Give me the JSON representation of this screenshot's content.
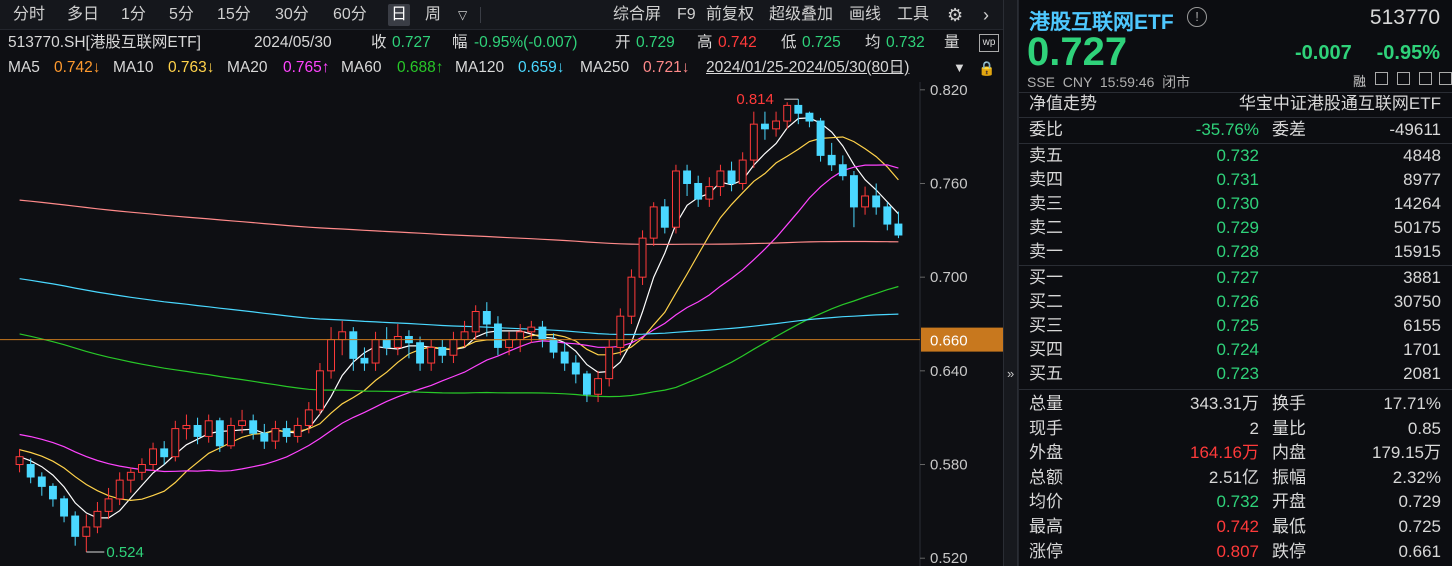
{
  "toolbar": {
    "periods": [
      "分时",
      "多日",
      "1分",
      "5分",
      "15分",
      "30分",
      "60分",
      "日",
      "周"
    ],
    "selected": "日",
    "dropdown_icon": "caret-down-icon",
    "tools": [
      "综合屏",
      "F9",
      "前复权",
      "超级叠加",
      "画线",
      "工具"
    ],
    "settings_icon": "gear-icon",
    "next_icon": "chevron-right-icon"
  },
  "info": {
    "code_name": "513770.SH[港股互联网ETF]",
    "date": "2024/05/30",
    "close_label": "收",
    "close": "0.727",
    "change_label": "幅",
    "change": "-0.95%(-0.007)",
    "open_label": "开",
    "open": "0.729",
    "high_label": "高",
    "high": "0.742",
    "low_label": "低",
    "low": "0.725",
    "avg_label": "均",
    "avg": "0.732",
    "vol_label": "量"
  },
  "ma": {
    "ma5": "MA5",
    "ma5_val": "0.742↓",
    "ma10": "MA10",
    "ma10_val": "0.763↓",
    "ma20": "MA20",
    "ma20_val": "0.765↑",
    "ma60": "MA60",
    "ma60_val": "0.688↑",
    "ma120": "MA120",
    "ma120_val": "0.659↓",
    "ma250": "MA250",
    "ma250_val": "0.721↓",
    "range": "2024/01/25-2024/05/30(80日)"
  },
  "chart_data": {
    "type": "candlestick",
    "y_ticks": [
      "0.820",
      "0.760",
      "0.700",
      "0.640",
      "0.580",
      "0.520"
    ],
    "ylim": [
      0.515,
      0.825
    ],
    "price_marker": "0.660",
    "high_annotation": "0.814",
    "low_annotation": "0.524",
    "candles": [
      [
        0.58,
        0.585,
        0.575,
        0.59
      ],
      [
        0.58,
        0.572,
        0.568,
        0.584
      ],
      [
        0.572,
        0.566,
        0.56,
        0.575
      ],
      [
        0.566,
        0.558,
        0.553,
        0.568
      ],
      [
        0.558,
        0.547,
        0.543,
        0.56
      ],
      [
        0.547,
        0.534,
        0.528,
        0.55
      ],
      [
        0.534,
        0.54,
        0.524,
        0.548
      ],
      [
        0.54,
        0.55,
        0.536,
        0.556
      ],
      [
        0.55,
        0.558,
        0.545,
        0.565
      ],
      [
        0.558,
        0.57,
        0.554,
        0.575
      ],
      [
        0.57,
        0.575,
        0.562,
        0.578
      ],
      [
        0.575,
        0.58,
        0.57,
        0.584
      ],
      [
        0.58,
        0.59,
        0.576,
        0.594
      ],
      [
        0.59,
        0.585,
        0.58,
        0.595
      ],
      [
        0.585,
        0.603,
        0.582,
        0.608
      ],
      [
        0.603,
        0.605,
        0.596,
        0.612
      ],
      [
        0.605,
        0.598,
        0.593,
        0.61
      ],
      [
        0.598,
        0.608,
        0.594,
        0.612
      ],
      [
        0.608,
        0.592,
        0.588,
        0.61
      ],
      [
        0.592,
        0.605,
        0.59,
        0.61
      ],
      [
        0.605,
        0.608,
        0.6,
        0.615
      ],
      [
        0.608,
        0.6,
        0.596,
        0.612
      ],
      [
        0.6,
        0.595,
        0.59,
        0.606
      ],
      [
        0.595,
        0.603,
        0.59,
        0.608
      ],
      [
        0.603,
        0.598,
        0.594,
        0.608
      ],
      [
        0.598,
        0.605,
        0.594,
        0.61
      ],
      [
        0.605,
        0.615,
        0.6,
        0.62
      ],
      [
        0.615,
        0.64,
        0.612,
        0.645
      ],
      [
        0.64,
        0.66,
        0.635,
        0.668
      ],
      [
        0.66,
        0.665,
        0.65,
        0.672
      ],
      [
        0.665,
        0.648,
        0.64,
        0.668
      ],
      [
        0.648,
        0.645,
        0.64,
        0.655
      ],
      [
        0.645,
        0.66,
        0.64,
        0.665
      ],
      [
        0.66,
        0.655,
        0.65,
        0.668
      ],
      [
        0.655,
        0.662,
        0.65,
        0.67
      ],
      [
        0.662,
        0.658,
        0.648,
        0.666
      ],
      [
        0.658,
        0.645,
        0.64,
        0.662
      ],
      [
        0.645,
        0.655,
        0.64,
        0.66
      ],
      [
        0.655,
        0.65,
        0.645,
        0.66
      ],
      [
        0.65,
        0.66,
        0.645,
        0.665
      ],
      [
        0.66,
        0.665,
        0.655,
        0.672
      ],
      [
        0.665,
        0.678,
        0.66,
        0.682
      ],
      [
        0.678,
        0.67,
        0.662,
        0.684
      ],
      [
        0.67,
        0.655,
        0.65,
        0.675
      ],
      [
        0.655,
        0.66,
        0.65,
        0.665
      ],
      [
        0.66,
        0.665,
        0.652,
        0.67
      ],
      [
        0.665,
        0.668,
        0.658,
        0.672
      ],
      [
        0.668,
        0.66,
        0.655,
        0.672
      ],
      [
        0.66,
        0.652,
        0.648,
        0.664
      ],
      [
        0.652,
        0.645,
        0.64,
        0.658
      ],
      [
        0.645,
        0.638,
        0.632,
        0.65
      ],
      [
        0.638,
        0.625,
        0.62,
        0.64
      ],
      [
        0.625,
        0.635,
        0.62,
        0.64
      ],
      [
        0.635,
        0.655,
        0.63,
        0.66
      ],
      [
        0.655,
        0.675,
        0.65,
        0.68
      ],
      [
        0.675,
        0.7,
        0.67,
        0.705
      ],
      [
        0.7,
        0.725,
        0.695,
        0.73
      ],
      [
        0.725,
        0.745,
        0.72,
        0.748
      ],
      [
        0.745,
        0.732,
        0.728,
        0.75
      ],
      [
        0.732,
        0.768,
        0.728,
        0.772
      ],
      [
        0.768,
        0.76,
        0.752,
        0.772
      ],
      [
        0.76,
        0.75,
        0.745,
        0.765
      ],
      [
        0.75,
        0.758,
        0.745,
        0.764
      ],
      [
        0.758,
        0.768,
        0.752,
        0.772
      ],
      [
        0.768,
        0.76,
        0.755,
        0.774
      ],
      [
        0.76,
        0.775,
        0.756,
        0.78
      ],
      [
        0.775,
        0.798,
        0.77,
        0.806
      ],
      [
        0.798,
        0.795,
        0.788,
        0.806
      ],
      [
        0.795,
        0.8,
        0.79,
        0.806
      ],
      [
        0.8,
        0.81,
        0.795,
        0.812
      ],
      [
        0.81,
        0.805,
        0.798,
        0.814
      ],
      [
        0.805,
        0.8,
        0.796,
        0.806
      ],
      [
        0.8,
        0.778,
        0.774,
        0.802
      ],
      [
        0.778,
        0.772,
        0.768,
        0.786
      ],
      [
        0.772,
        0.765,
        0.762,
        0.778
      ],
      [
        0.765,
        0.745,
        0.732,
        0.768
      ],
      [
        0.745,
        0.752,
        0.74,
        0.758
      ],
      [
        0.752,
        0.745,
        0.74,
        0.76
      ],
      [
        0.745,
        0.734,
        0.73,
        0.748
      ],
      [
        0.734,
        0.727,
        0.725,
        0.742
      ]
    ]
  },
  "right": {
    "title": "港股互联网ETF",
    "info_icon": "info-icon",
    "code": "513770",
    "price": "0.727",
    "change": "-0.007",
    "change_pct": "-0.95%",
    "meta": "SSE  CNY  15:59:46  闭市",
    "nav_label": "净值走势",
    "fund_name": "华宝中证港股通互联网ETF",
    "weibi_label": "委比",
    "weibi": "-35.76%",
    "weicha_label": "委差",
    "weicha": "-49611",
    "asks": [
      {
        "label": "卖五",
        "price": "0.732",
        "vol": "4848"
      },
      {
        "label": "卖四",
        "price": "0.731",
        "vol": "8977"
      },
      {
        "label": "卖三",
        "price": "0.730",
        "vol": "14264"
      },
      {
        "label": "卖二",
        "price": "0.729",
        "vol": "50175"
      },
      {
        "label": "卖一",
        "price": "0.728",
        "vol": "15915"
      }
    ],
    "bids": [
      {
        "label": "买一",
        "price": "0.727",
        "vol": "3881"
      },
      {
        "label": "买二",
        "price": "0.726",
        "vol": "30750"
      },
      {
        "label": "买三",
        "price": "0.725",
        "vol": "6155"
      },
      {
        "label": "买四",
        "price": "0.724",
        "vol": "1701"
      },
      {
        "label": "买五",
        "price": "0.723",
        "vol": "2081"
      }
    ],
    "stats": [
      {
        "l1": "总量",
        "v1": "343.31万",
        "c1": "white",
        "l2": "换手",
        "v2": "17.71%",
        "c2": "white"
      },
      {
        "l1": "现手",
        "v1": "2",
        "c1": "white",
        "l2": "量比",
        "v2": "0.85",
        "c2": "white"
      },
      {
        "l1": "外盘",
        "v1": "164.16万",
        "c1": "red",
        "l2": "内盘",
        "v2": "179.15万",
        "c2": "green"
      },
      {
        "l1": "总额",
        "v1": "2.51亿",
        "c1": "white",
        "l2": "振幅",
        "v2": "2.32%",
        "c2": "white"
      },
      {
        "l1": "均价",
        "v1": "0.732",
        "c1": "green",
        "l2": "开盘",
        "v2": "0.729",
        "c2": "green"
      },
      {
        "l1": "最高",
        "v1": "0.742",
        "c1": "red",
        "l2": "最低",
        "v2": "0.725",
        "c2": "green"
      },
      {
        "l1": "涨停",
        "v1": "0.807",
        "c1": "red",
        "l2": "跌停",
        "v2": "0.661",
        "c2": "green"
      }
    ]
  }
}
